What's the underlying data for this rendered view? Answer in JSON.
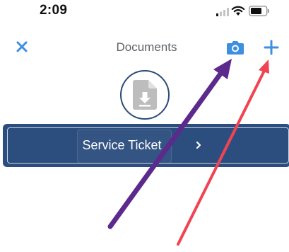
{
  "status_bar": {
    "time": "2:09"
  },
  "nav": {
    "title": "Documents",
    "close_icon": "close-icon",
    "camera_icon": "camera-icon",
    "add_icon": "plus-icon"
  },
  "document_icon": "document-download-icon",
  "service_ticket": {
    "label": "Service Ticket",
    "chevron_icon": "chevron-right-icon"
  },
  "colors": {
    "accent": "#3d8fe0",
    "button_bg": "#2c4e7e",
    "annotation_purple": "#5b2a8c",
    "annotation_red": "#f04452"
  }
}
